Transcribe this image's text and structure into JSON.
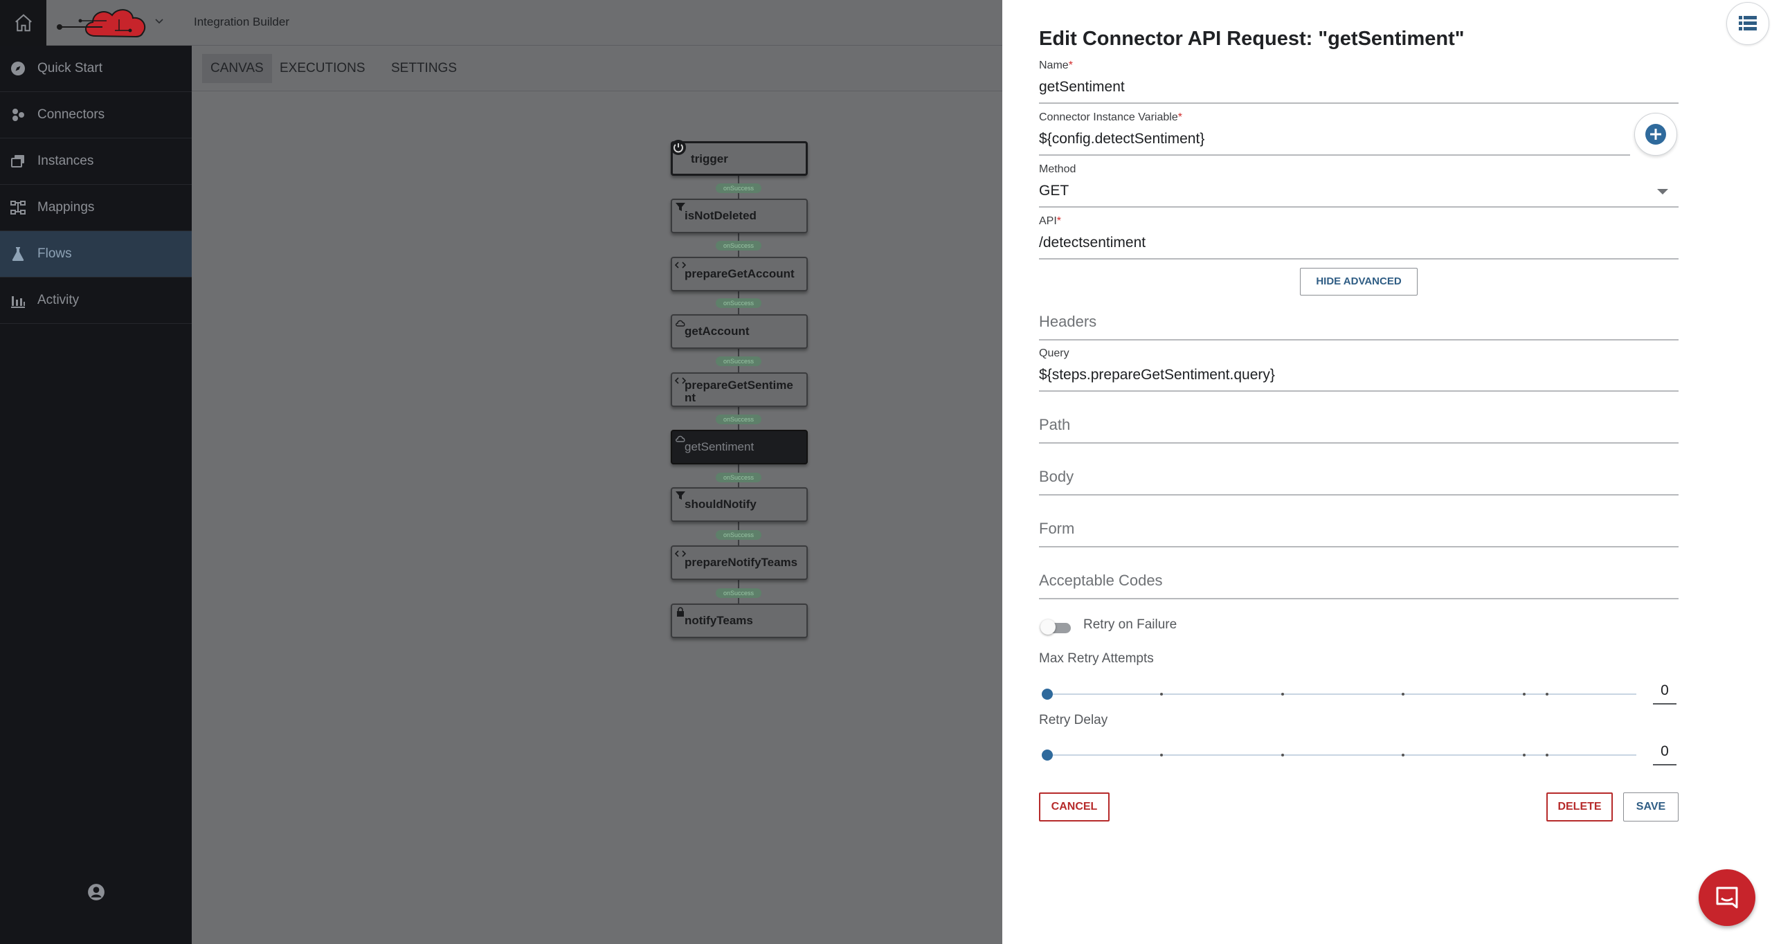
{
  "app": {
    "title": "Integration Builder"
  },
  "sidebar": {
    "items": [
      {
        "label": "Quick Start",
        "icon": "compass-icon"
      },
      {
        "label": "Connectors",
        "icon": "connectors-icon"
      },
      {
        "label": "Instances",
        "icon": "instances-icon"
      },
      {
        "label": "Mappings",
        "icon": "mappings-icon"
      },
      {
        "label": "Flows",
        "icon": "flask-icon",
        "active": true
      },
      {
        "label": "Activity",
        "icon": "bar-chart-icon"
      }
    ]
  },
  "tabs": [
    {
      "label": "CANVAS",
      "active": true
    },
    {
      "label": "EXECUTIONS"
    },
    {
      "label": "SETTINGS"
    }
  ],
  "flow": {
    "nodes": [
      {
        "label": "trigger",
        "icon": "trigger-icon"
      },
      {
        "label": "isNotDeleted",
        "icon": "filter-icon"
      },
      {
        "label": "prepareGetAccount",
        "icon": "code-icon"
      },
      {
        "label": "getAccount",
        "icon": "cloud-icon"
      },
      {
        "label": "prepareGetSentime",
        "label2": "nt",
        "icon": "code-icon"
      },
      {
        "label": "getSentiment",
        "icon": "cloud-icon",
        "selected": true
      },
      {
        "label": "shouldNotify",
        "icon": "filter-icon"
      },
      {
        "label": "prepareNotifyTeams",
        "icon": "code-icon"
      },
      {
        "label": "notifyTeams",
        "icon": "lock-icon"
      }
    ],
    "edge_label": "onSuccess"
  },
  "drawer": {
    "title": "Edit Connector API Request: \"getSentiment\"",
    "name": {
      "label": "Name",
      "required": "*",
      "value": "getSentiment"
    },
    "instance_var": {
      "label": "Connector Instance Variable",
      "required": "*",
      "value": "${config.detectSentiment}"
    },
    "method": {
      "label": "Method",
      "value": "GET"
    },
    "api": {
      "label": "API",
      "required": "*",
      "value": "/detectsentiment"
    },
    "hide_advanced": "HIDE ADVANCED",
    "headers": {
      "placeholder": "Headers"
    },
    "query": {
      "label": "Query",
      "value": "${steps.prepareGetSentiment.query}"
    },
    "path": {
      "placeholder": "Path"
    },
    "body": {
      "placeholder": "Body"
    },
    "form": {
      "placeholder": "Form"
    },
    "acceptable_codes": {
      "placeholder": "Acceptable Codes"
    },
    "retry_on_failure": {
      "label": "Retry on Failure",
      "on": false
    },
    "max_retry": {
      "label": "Max Retry Attempts",
      "value": "0"
    },
    "retry_delay": {
      "label": "Retry Delay",
      "value": "0"
    },
    "buttons": {
      "cancel": "CANCEL",
      "delete": "DELETE",
      "save": "SAVE"
    }
  },
  "colors": {
    "accent": "#2f6a9c",
    "danger": "#b62a2a",
    "chat": "#c7242b",
    "sidebar_bg": "#141519",
    "active_nav": "#2a3a4b"
  }
}
